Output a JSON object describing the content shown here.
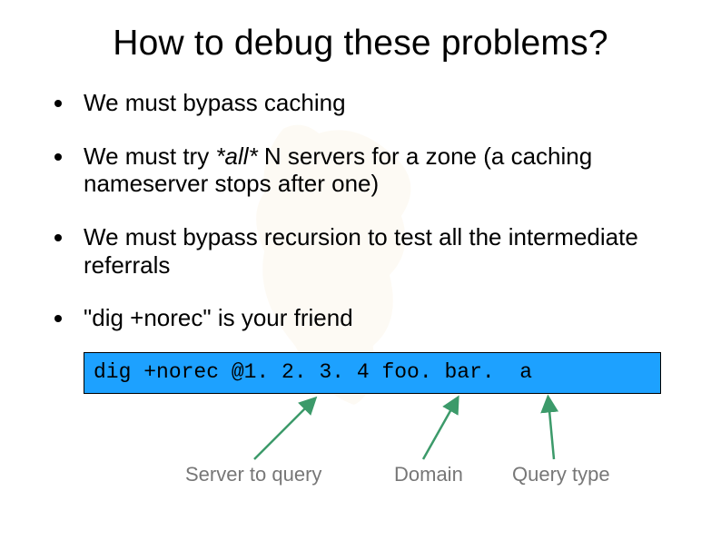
{
  "title": "How to debug these problems?",
  "bullets": [
    {
      "text": "We must bypass caching"
    },
    {
      "text_pre": "We must try ",
      "emph": "*all*",
      "text_post": " N servers for a zone (a caching nameserver stops after one)"
    },
    {
      "text": "We must bypass recursion to test all the intermediate referrals"
    },
    {
      "text": "\"dig +norec\" is your friend"
    }
  ],
  "command": "dig +norec @1. 2. 3. 4 foo. bar.  a",
  "labels": {
    "server": "Server to query",
    "domain": "Domain",
    "qtype": "Query type"
  },
  "colors": {
    "cmd_bg": "#1da1ff",
    "arrow": "#3c9a6a",
    "label": "#777777"
  }
}
